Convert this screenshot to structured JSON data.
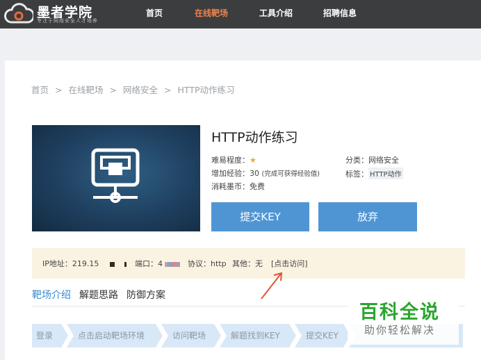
{
  "brand": {
    "title": "墨者学院",
    "subtitle": "专注于网络安全人才培养"
  },
  "nav": {
    "items": [
      "首页",
      "在线靶场",
      "工具介绍",
      "招聘信息"
    ],
    "active_index": 1,
    "accent": "#f0824a"
  },
  "breadcrumb": {
    "items": [
      "首页",
      "在线靶场",
      "网络安全",
      "HTTP动作练习"
    ],
    "separator": ">"
  },
  "lab": {
    "title": "HTTP动作练习",
    "difficulty_label": "难易程度：",
    "difficulty_stars": 1,
    "exp_label": "增加经验：30",
    "exp_note": "(完成可获得经验值)",
    "cost_label": "消耗墨币：免费",
    "category_label": "分类：网络安全",
    "tag_label": "标签：",
    "tag_value": "HTTP动作"
  },
  "buttons": {
    "submit": "提交KEY",
    "abandon": "放弃",
    "color": "#4f95d4"
  },
  "info": {
    "ip": "IP地址：219.15",
    "port": "端口：4",
    "protocol": "协议：http",
    "other": "其他：无",
    "visit": "[点击访问]"
  },
  "tabs": {
    "items": [
      "靶场介绍",
      "解题思路",
      "防御方案"
    ],
    "active_index": 0
  },
  "steps": [
    "登录",
    "点击启动靶场环境",
    "访问靶场",
    "解题找到KEY",
    "提交KEY"
  ],
  "watermark": {
    "big": "百科全说",
    "small": "助你轻松解决"
  }
}
